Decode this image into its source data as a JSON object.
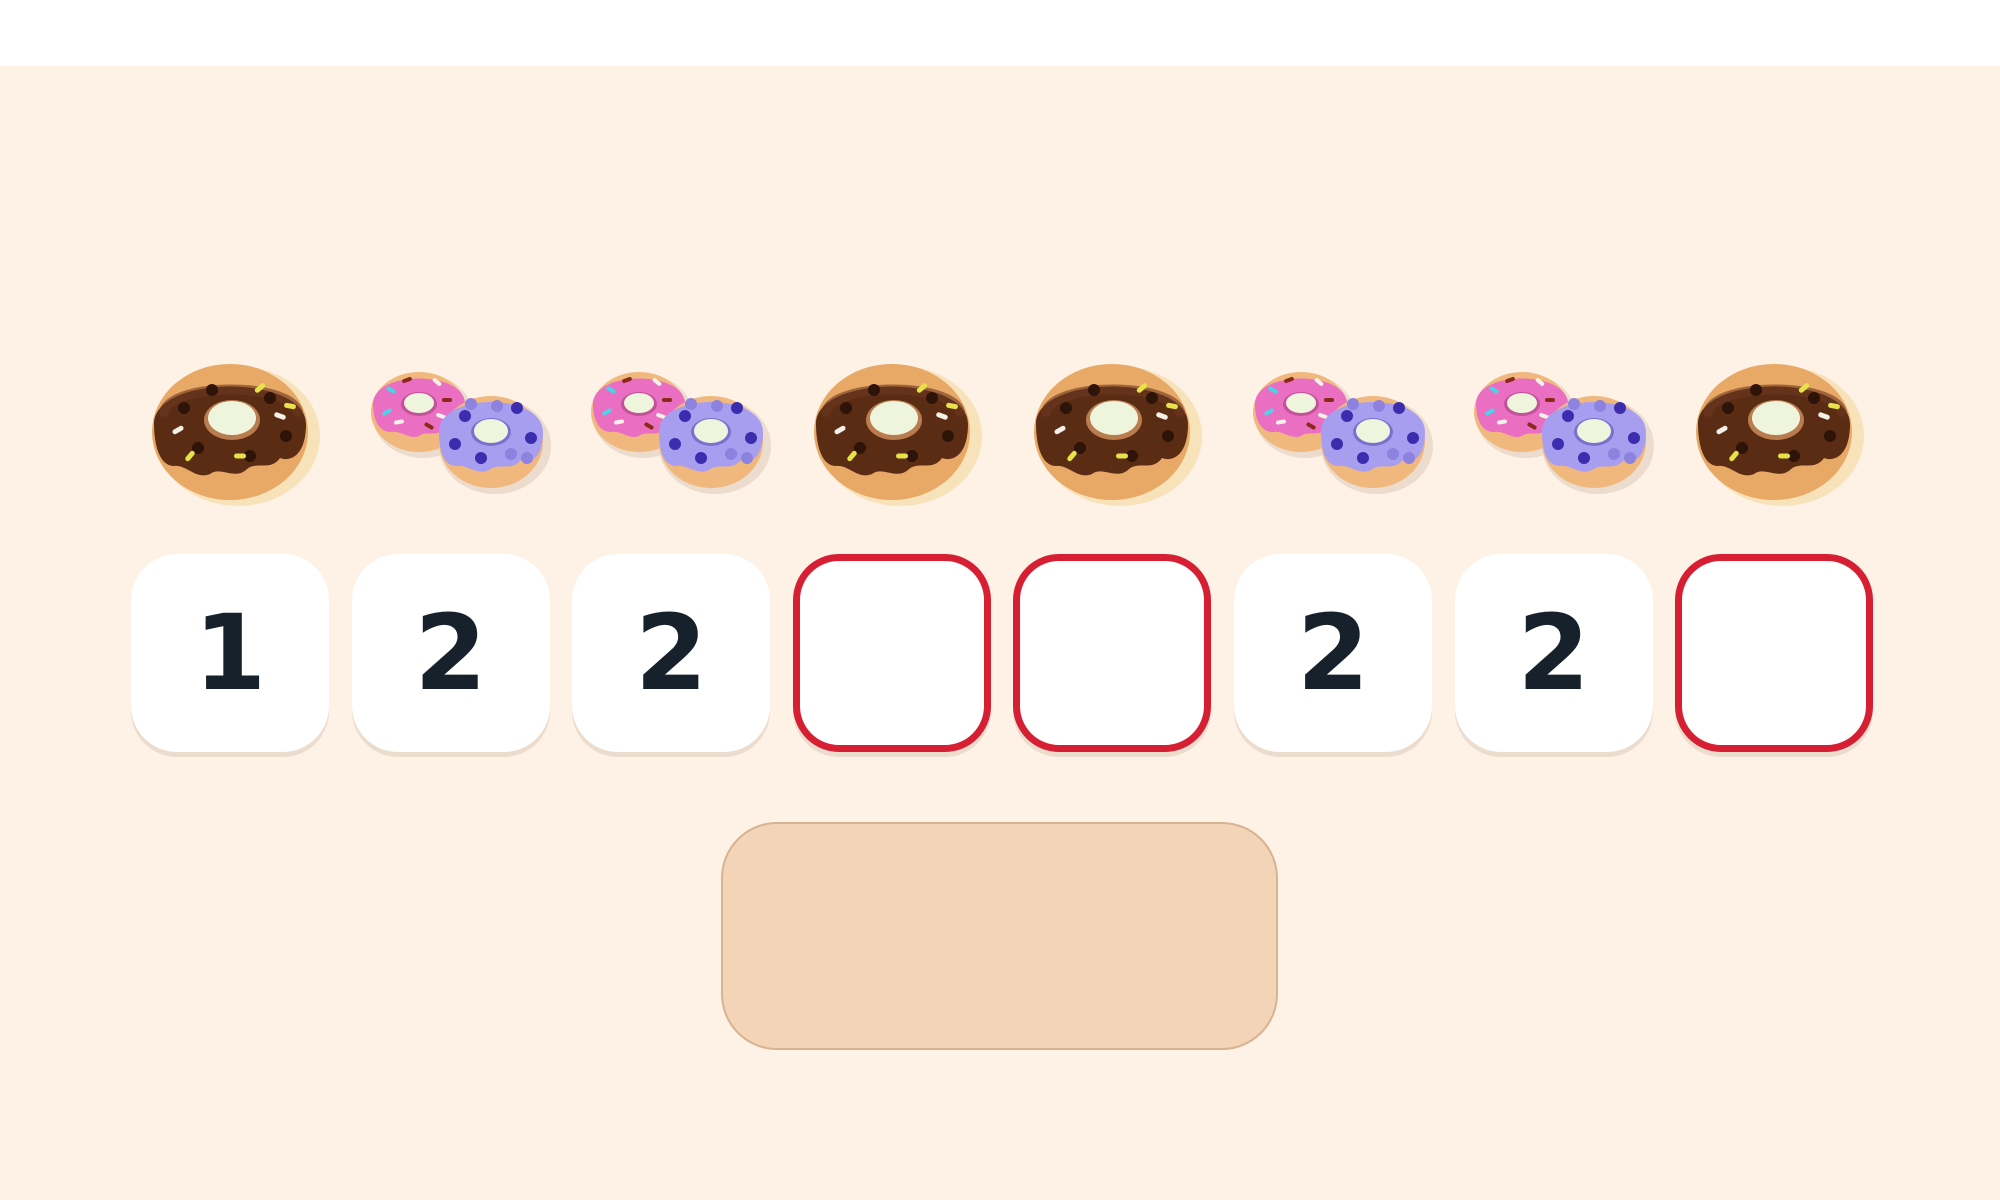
{
  "sequence": [
    {
      "kind": "chocolate",
      "count": 1,
      "value": "1",
      "filled": true
    },
    {
      "kind": "pair",
      "count": 2,
      "value": "2",
      "filled": true
    },
    {
      "kind": "pair",
      "count": 2,
      "value": "2",
      "filled": true
    },
    {
      "kind": "chocolate",
      "count": 1,
      "value": "",
      "filled": false
    },
    {
      "kind": "chocolate",
      "count": 1,
      "value": "",
      "filled": false
    },
    {
      "kind": "pair",
      "count": 2,
      "value": "2",
      "filled": true
    },
    {
      "kind": "pair",
      "count": 2,
      "value": "2",
      "filled": true
    },
    {
      "kind": "chocolate",
      "count": 1,
      "value": "",
      "filled": false
    }
  ],
  "icons": {
    "chocolate": "chocolate-donut-icon",
    "pink": "pink-sprinkle-donut-icon",
    "purple": "purple-donut-icon"
  },
  "colors": {
    "background": "#fef1e6",
    "empty_slot_border": "#d61f32",
    "number": "#17212b",
    "answer_area": "#f3d4b7"
  }
}
